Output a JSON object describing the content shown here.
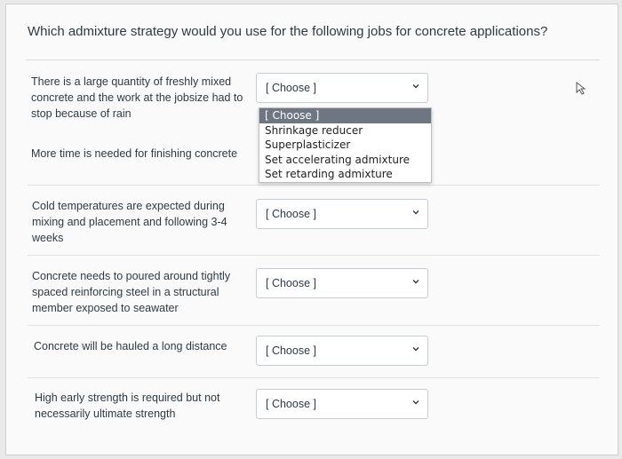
{
  "question": "Which admixture strategy would you use for the following jobs for concrete applications?",
  "rows": [
    {
      "label_lines": [
        "There is a large quantity of freshly mixed",
        "concrete and the work at the jobsize had to",
        "stop because of rain"
      ],
      "selected": "[ Choose ]"
    },
    {
      "label_lines": [
        "More time is needed for finishing concrete"
      ],
      "selected": "[ Choose ]"
    },
    {
      "label_lines": [
        "Cold temperatures are expected during",
        "mixing and placement and following 3-4",
        "weeks"
      ],
      "selected": "[ Choose ]"
    },
    {
      "label_lines": [
        "Concrete needs to poured around tightly",
        "spaced reinforcing steel in a structural",
        "member exposed to seawater"
      ],
      "selected": "[ Choose ]"
    },
    {
      "label_lines": [
        "Concrete will be hauled a long distance"
      ],
      "selected": "[ Choose ]"
    },
    {
      "label_lines": [
        "High early strength is required but not",
        "necessarily ultimate strength"
      ],
      "selected": "[ Choose ]"
    }
  ],
  "dropdown_options": [
    "[ Choose ]",
    "Shrinkage reducer",
    "Superplasticizer",
    "Set accelerating admixture",
    "Set retarding admixture"
  ],
  "colors": {
    "text": "#2d3b45",
    "selected_option_bg": "#6e7681",
    "select_border": "#c7cdd1"
  }
}
